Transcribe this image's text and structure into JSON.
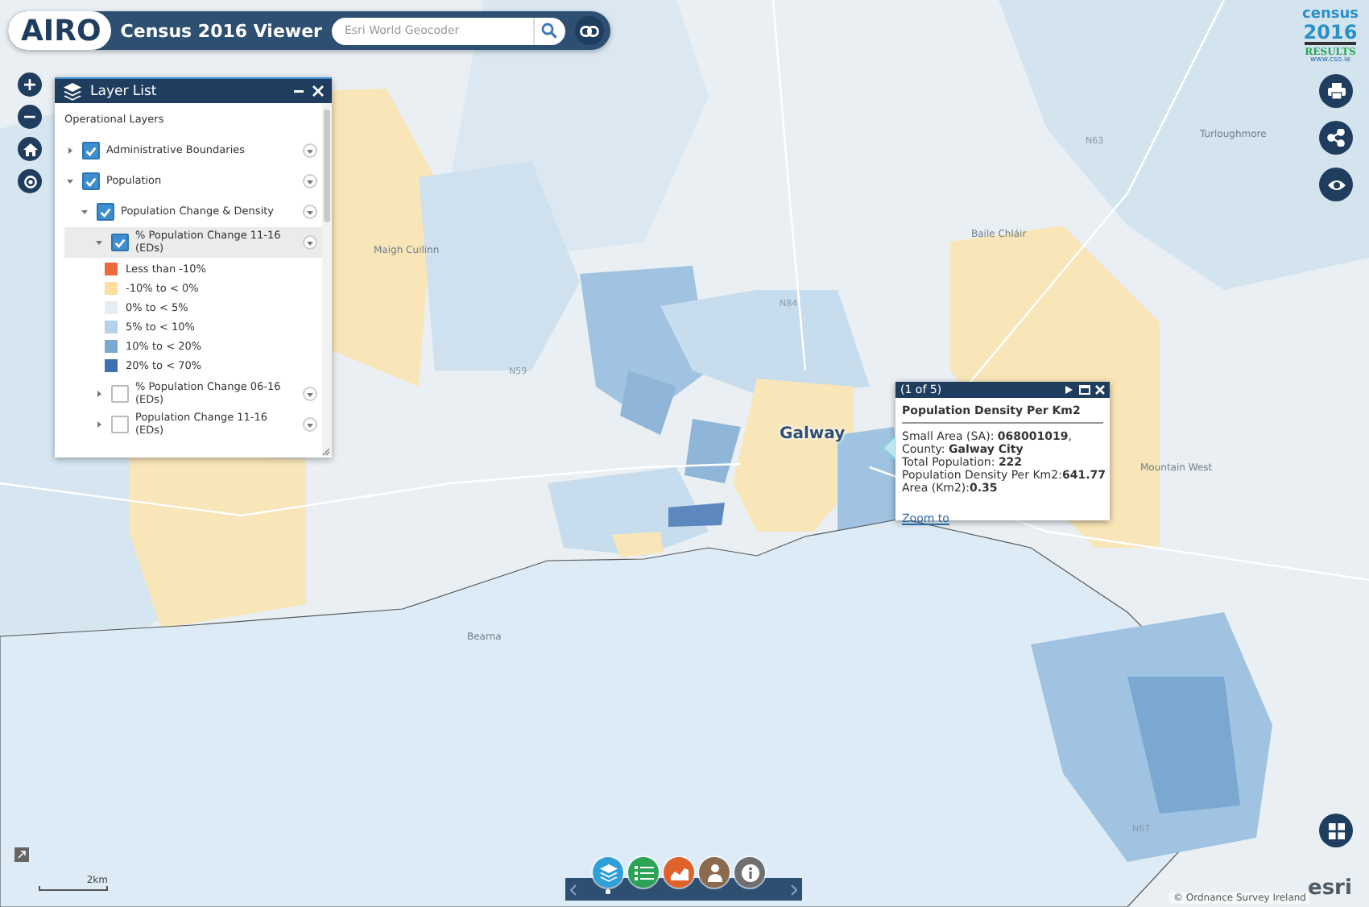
{
  "header": {
    "logo": "AIRO",
    "title": "Census 2016 Viewer",
    "search": {
      "placeholder": "Esri World Geocoder"
    }
  },
  "census_logo": {
    "line_1": "census",
    "line_2": "2016",
    "line_3": "RESULTS",
    "line_4": "www.cso.ie"
  },
  "map_controls": [
    {
      "kind": "zoom_in",
      "label": "+"
    },
    {
      "kind": "zoom_out",
      "label": "−"
    },
    {
      "kind": "home"
    },
    {
      "kind": "locate"
    }
  ],
  "side_buttons": [
    {
      "kind": "print"
    },
    {
      "kind": "share"
    },
    {
      "kind": "eye"
    }
  ],
  "layer_list": {
    "title": "Layer List",
    "heading": "Operational Layers",
    "layers": [
      {
        "label": "Administrative Boundaries",
        "checked": true,
        "expanded": false,
        "selected": false
      },
      {
        "label": "Population",
        "checked": true,
        "expanded": true,
        "selected": false,
        "children": [
          {
            "label": "Population Change & Density",
            "checked": true,
            "expanded": true,
            "selected": false,
            "children": [
              {
                "label": "% Population Change 11-16 (EDs)",
                "checked": true,
                "expanded": true,
                "selected": true,
                "legend": [
                  {
                    "label": "Less than -10%",
                    "color": "#ee6a3c"
                  },
                  {
                    "label": "-10% to < 0%",
                    "color": "#fbe0a0"
                  },
                  {
                    "label": "0% to < 5%",
                    "color": "#e4eef6"
                  },
                  {
                    "label": "5% to < 10%",
                    "color": "#b3d3ea"
                  },
                  {
                    "label": "10% to < 20%",
                    "color": "#7aa8d0"
                  },
                  {
                    "label": "20% to < 70%",
                    "color": "#3f6fae"
                  }
                ]
              },
              {
                "label": "% Population Change 06-16 (EDs)",
                "checked": false,
                "expanded": false,
                "selected": false
              },
              {
                "label": "Population Change 11-16 (EDs)",
                "checked": false,
                "expanded": false,
                "selected": false
              }
            ]
          }
        ]
      }
    ]
  },
  "popup": {
    "counter": "(1 of 5)",
    "title": "Population Density Per Km2",
    "lines": [
      "Small Area (SA): **068001019**,",
      "County: **Galway City**",
      "Total Population: **222**",
      "Population Density Per Km2:**641.77**",
      "Area (Km2):**0.35**"
    ],
    "link": "Zoom to"
  },
  "map_labels": [
    {
      "text": "Maigh Cuilinn",
      "kind": "place"
    },
    {
      "text": "Galway",
      "kind": "city"
    },
    {
      "text": "Bearna",
      "kind": "place"
    },
    {
      "text": "Baile Chláir",
      "kind": "place"
    },
    {
      "text": "Mountain West",
      "kind": "place"
    },
    {
      "text": "Turloughmore",
      "kind": "place"
    },
    {
      "text": "N59",
      "kind": "road"
    },
    {
      "text": "N84",
      "kind": "road"
    },
    {
      "text": "N63",
      "kind": "road"
    },
    {
      "text": "N67",
      "kind": "road"
    }
  ],
  "dock": {
    "buttons": [
      {
        "kind": "layers",
        "color": "#2f9fd8",
        "selected": true
      },
      {
        "kind": "legend",
        "color": "#2aa355",
        "selected": false
      },
      {
        "kind": "chart",
        "color": "#e0622b",
        "selected": false
      },
      {
        "kind": "person",
        "color": "#8c6a4e",
        "selected": false
      },
      {
        "kind": "info",
        "color": "#6f6f6f",
        "selected": false
      }
    ]
  },
  "scale": {
    "label": "2km"
  },
  "attribution": "© Ordnance Survey Ireland",
  "esri_logo": "esri"
}
